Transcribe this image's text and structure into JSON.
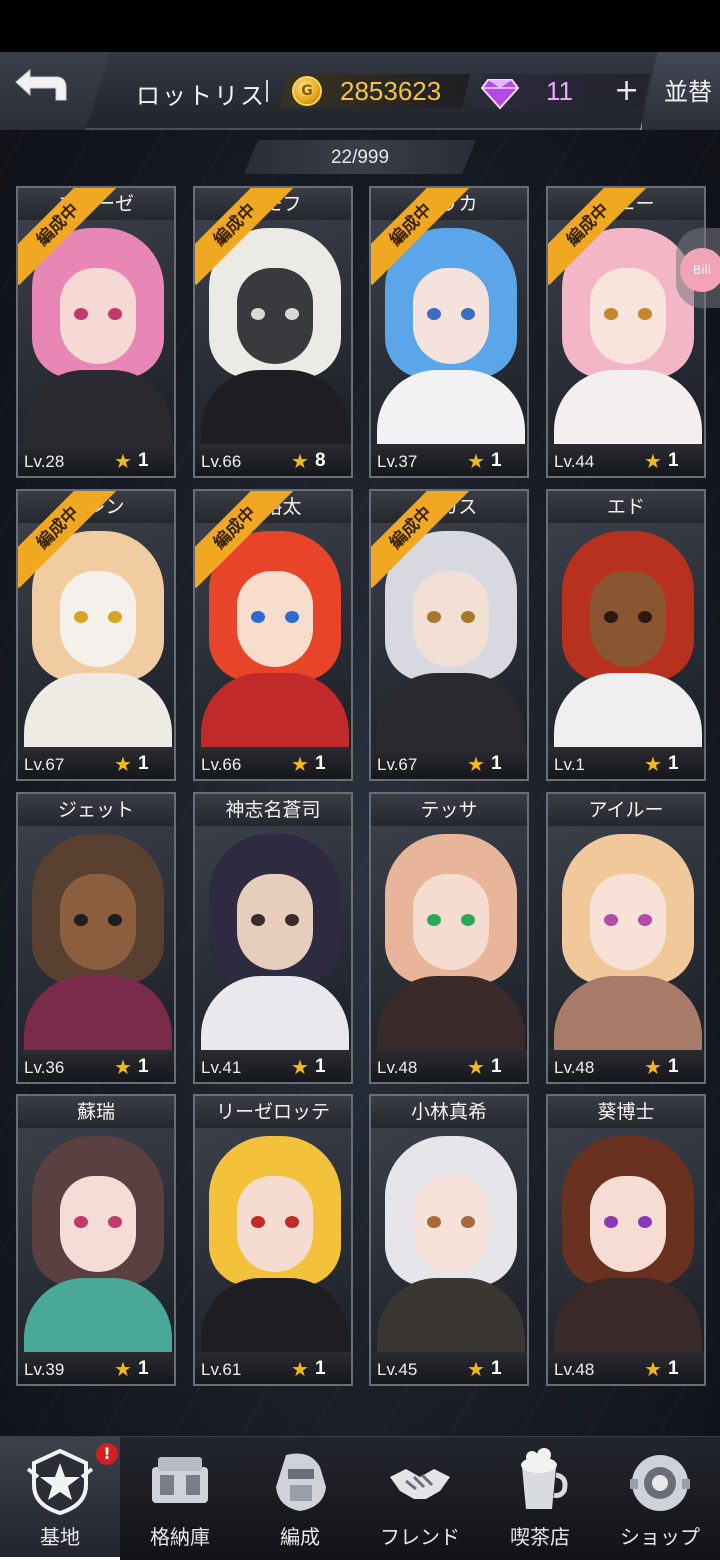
{
  "header": {
    "player_name": "ロットリス",
    "gold": "2853623",
    "gems": "11",
    "plus_label": "+",
    "sort_label": "並替"
  },
  "inventory": {
    "count": "22/999"
  },
  "badge_label": "編成中",
  "characters": [
    {
      "name": "エリーゼ",
      "level": "Lv.28",
      "stars": "1",
      "in_team": true,
      "hair": "#e886b6",
      "skin": "#f6d8d4",
      "eye": "#c23a6a",
      "outfit": "#2a2a30"
    },
    {
      "name": "ベモフ",
      "level": "Lv.66",
      "stars": "8",
      "in_team": true,
      "hair": "#eceae4",
      "skin": "#3a3a3e",
      "eye": "#d8d8d8",
      "outfit": "#1e1e22"
    },
    {
      "name": "エリカ",
      "level": "Lv.37",
      "stars": "1",
      "in_team": true,
      "hair": "#5aa6e8",
      "skin": "#f6e2dc",
      "eye": "#3a6ec2",
      "outfit": "#f2f2f4"
    },
    {
      "name": "サニー",
      "level": "Lv.44",
      "stars": "1",
      "in_team": true,
      "hair": "#f2b6c6",
      "skin": "#f8e4dc",
      "eye": "#c8862a",
      "outfit": "#f4eeee"
    },
    {
      "name": "イレン",
      "level": "Lv.67",
      "stars": "1",
      "in_team": true,
      "hair": "#f0cca0",
      "skin": "#f4f0ec",
      "eye": "#d6a422",
      "outfit": "#eeeae4"
    },
    {
      "name": "星裕太",
      "level": "Lv.66",
      "stars": "1",
      "in_team": true,
      "hair": "#e8442a",
      "skin": "#f8dccc",
      "eye": "#2a6ad2",
      "outfit": "#c02a2a"
    },
    {
      "name": "ルカス",
      "level": "Lv.67",
      "stars": "1",
      "in_team": true,
      "hair": "#d8d8e0",
      "skin": "#f2e0d6",
      "eye": "#a8782a",
      "outfit": "#2a2a2e"
    },
    {
      "name": "エド",
      "level": "Lv.1",
      "stars": "1",
      "in_team": false,
      "hair": "#b8301e",
      "skin": "#8a5632",
      "eye": "#2a1a10",
      "outfit": "#efefef"
    },
    {
      "name": "ジェット",
      "level": "Lv.36",
      "stars": "1",
      "in_team": false,
      "hair": "#5a4030",
      "skin": "#8a5e3e",
      "eye": "#1e1e1e",
      "outfit": "#7a2a4a"
    },
    {
      "name": "神志名蒼司",
      "level": "Lv.41",
      "stars": "1",
      "in_team": false,
      "hair": "#2e2a40",
      "skin": "#e6cdbc",
      "eye": "#3a2a2a",
      "outfit": "#e8e8ee"
    },
    {
      "name": "テッサ",
      "level": "Lv.48",
      "stars": "1",
      "in_team": false,
      "hair": "#e8b49a",
      "skin": "#f6dcd0",
      "eye": "#2aa85a",
      "outfit": "#3a2a2a"
    },
    {
      "name": "アイルー",
      "level": "Lv.48",
      "stars": "1",
      "in_team": false,
      "hair": "#f0c89a",
      "skin": "#f8e2d8",
      "eye": "#b84aa8",
      "outfit": "#a87a6a"
    },
    {
      "name": "蘇瑞",
      "level": "Lv.39",
      "stars": "1",
      "in_team": false,
      "hair": "#5a4040",
      "skin": "#f6dcd6",
      "eye": "#c23a6a",
      "outfit": "#4aa898"
    },
    {
      "name": "リーゼロッテ",
      "level": "Lv.61",
      "stars": "1",
      "in_team": false,
      "hair": "#f4c23a",
      "skin": "#f6dcd0",
      "eye": "#c22a2a",
      "outfit": "#1e1e22"
    },
    {
      "name": "小林真希",
      "level": "Lv.45",
      "stars": "1",
      "in_team": false,
      "hair": "#e6e6ea",
      "skin": "#f6e2da",
      "eye": "#a86a3a",
      "outfit": "#3a3632"
    },
    {
      "name": "葵博士",
      "level": "Lv.48",
      "stars": "1",
      "in_team": false,
      "hair": "#6a3020",
      "skin": "#f6dcd2",
      "eye": "#8a3ab8",
      "outfit": "#3a2a2a"
    }
  ],
  "nav": [
    {
      "label": "基地",
      "icon": "base-emblem-icon",
      "active": true,
      "alert": "!"
    },
    {
      "label": "格納庫",
      "icon": "hangar-icon",
      "active": false
    },
    {
      "label": "編成",
      "icon": "formation-icon",
      "active": false
    },
    {
      "label": "フレンド",
      "icon": "handshake-icon",
      "active": false
    },
    {
      "label": "喫茶店",
      "icon": "cafe-cup-icon",
      "active": false
    },
    {
      "label": "ショップ",
      "icon": "shop-capsule-icon",
      "active": false
    }
  ],
  "float_widget_label": "Bili"
}
